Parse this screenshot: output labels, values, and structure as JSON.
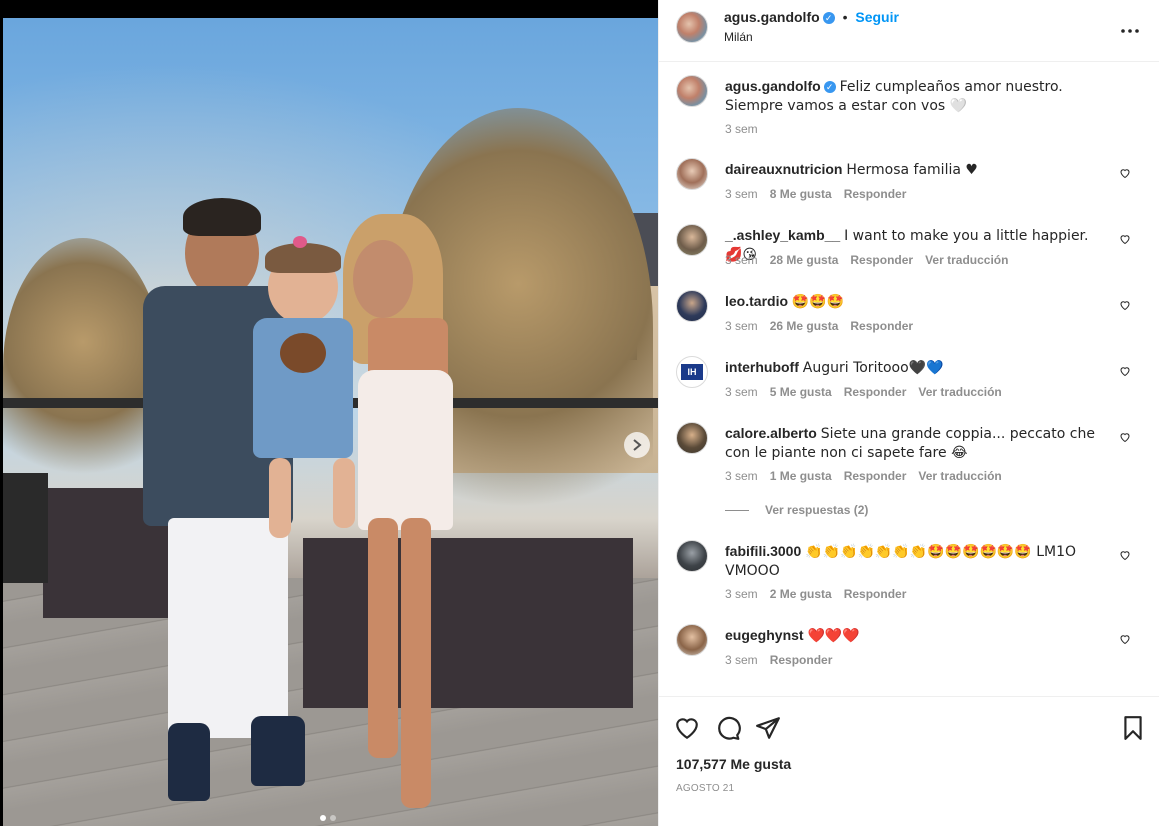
{
  "post": {
    "author": "agus.gandolfo",
    "follow_label": "Seguir",
    "location": "Milán",
    "more_icon": "more-horizontal-icon",
    "caption": {
      "username": "agus.gandolfo",
      "text": "Feliz cumpleaños amor nuestro. Siempre vamos a estar con vos 🤍",
      "time": "3 sem"
    },
    "carousel": {
      "total_slides": 2,
      "active_slide": 1,
      "next_icon": "chevron-right-icon"
    }
  },
  "comments": [
    {
      "username": "daireauxnutricion",
      "text": "Hermosa familia ♥",
      "time": "3 sem",
      "likes": "8 Me gusta",
      "reply": "Responder",
      "translate": ""
    },
    {
      "username": "_.ashley_kamb__",
      "text": "I want to make you a little happier.💋😘",
      "time": "3 sem",
      "likes": "28 Me gusta",
      "reply": "Responder",
      "translate": "Ver traducción"
    },
    {
      "username": "leo.tardio",
      "text": "🤩🤩🤩",
      "time": "3 sem",
      "likes": "26 Me gusta",
      "reply": "Responder",
      "translate": ""
    },
    {
      "username": "interhuboff",
      "text": "Auguri Toritooo🖤💙",
      "time": "3 sem",
      "likes": "5 Me gusta",
      "reply": "Responder",
      "translate": "Ver traducción"
    },
    {
      "username": "calore.alberto",
      "text": "Siete una grande coppia... peccato che con le piante non ci sapete fare 😂",
      "time": "3 sem",
      "likes": "1 Me gusta",
      "reply": "Responder",
      "translate": "Ver traducción",
      "view_replies": "Ver respuestas (2)"
    },
    {
      "username": "fabifili.3000",
      "text": "👏👏👏👏👏👏👏🤩🤩🤩🤩🤩🤩 LM1O VMOOO",
      "time": "3 sem",
      "likes": "2 Me gusta",
      "reply": "Responder",
      "translate": ""
    },
    {
      "username": "eugeghynst",
      "text": "❤️❤️❤️",
      "time": "3 sem",
      "likes": "",
      "reply": "Responder",
      "translate": ""
    }
  ],
  "footer": {
    "likes": "107,577 Me gusta",
    "date": "AGOSTO 21",
    "icons": [
      "heart-icon",
      "comment-icon",
      "share-icon",
      "bookmark-icon"
    ]
  },
  "colors": {
    "accent": "#0095f6",
    "verified": "#3897f0",
    "meta": "#8e8e8e",
    "text": "#262626"
  }
}
